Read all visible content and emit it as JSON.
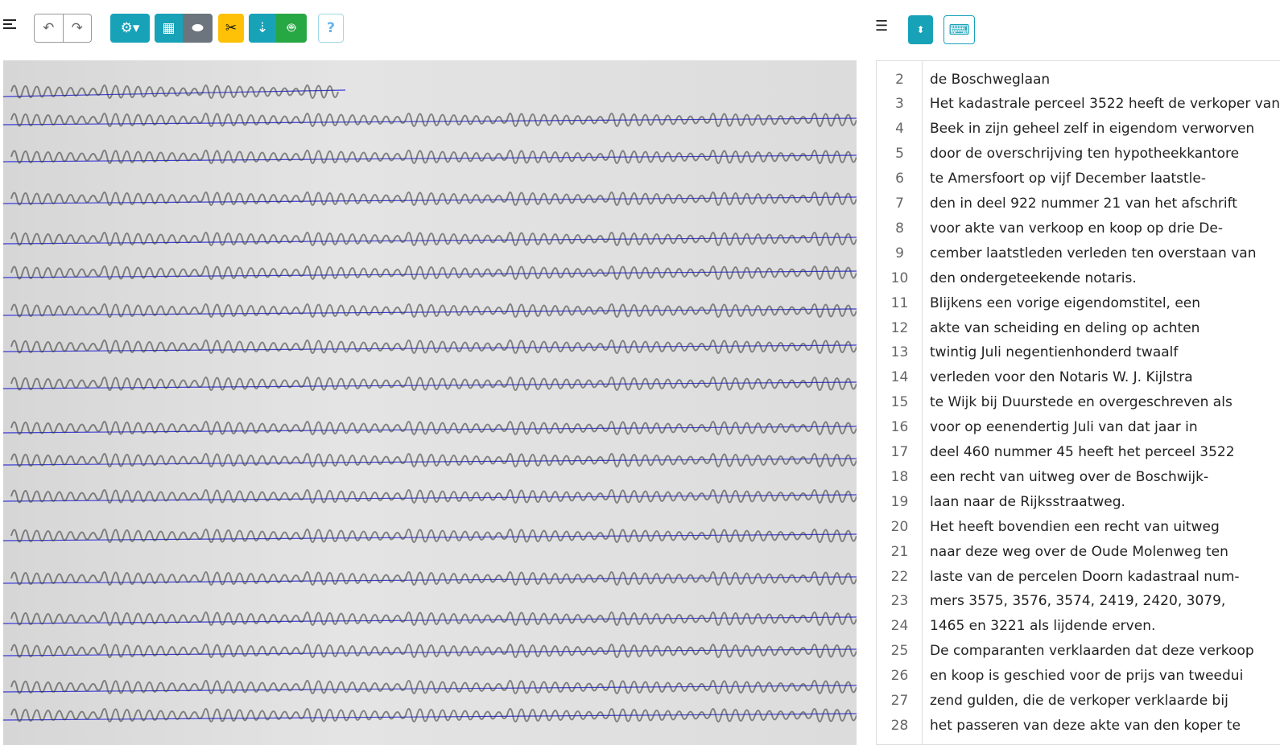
{
  "toolbar": {
    "help_label": "?",
    "colors": {
      "teal": "#17a2b8",
      "gray": "#6c757d",
      "yellow": "#ffc107",
      "green": "#28a745"
    }
  },
  "lines": [
    {
      "n": "2",
      "t": "de Boschweglaan"
    },
    {
      "n": "3",
      "t": "Het kadastrale perceel 3522 heeft de verkoper van"
    },
    {
      "n": "4",
      "t": "Beek in zijn geheel zelf in eigendom verworven"
    },
    {
      "n": "5",
      "t": "door de overschrijving ten hypotheekkantore"
    },
    {
      "n": "6",
      "t": "te Amersfoort op vijf December laatstle-"
    },
    {
      "n": "7",
      "t": "den in deel 922 nummer 21 van het afschrift"
    },
    {
      "n": "8",
      "t": "voor akte van verkoop en koop op drie De-"
    },
    {
      "n": "9",
      "t": "cember laatstleden verleden ten overstaan van"
    },
    {
      "n": "10",
      "t": "den ondergeteekende notaris."
    },
    {
      "n": "11",
      "t": "Blijkens een vorige eigendomstitel, een"
    },
    {
      "n": "12",
      "t": "akte van scheiding en deling op achten"
    },
    {
      "n": "13",
      "t": "twintig Juli negentienhonderd twaalf"
    },
    {
      "n": "14",
      "t": "verleden voor den Notaris W. J. Kijlstra"
    },
    {
      "n": "15",
      "t": "te Wijk bij Duurstede en overgeschreven als"
    },
    {
      "n": "16",
      "t": "voor op eenendertig Juli van dat jaar in"
    },
    {
      "n": "17",
      "t": "deel 460 nummer 45 heeft het perceel 3522"
    },
    {
      "n": "18",
      "t": "een recht van uitweg over de Boschwijk-"
    },
    {
      "n": "19",
      "t": "laan naar de Rijksstraatweg."
    },
    {
      "n": "20",
      "t": "Het heeft bovendien een recht van uitweg"
    },
    {
      "n": "21",
      "t": "naar deze weg over de Oude Molenweg ten"
    },
    {
      "n": "22",
      "t": "laste van de percelen Doorn kadastraal num-"
    },
    {
      "n": "23",
      "t": "mers 3575, 3576, 3574, 2419, 2420, 3079,"
    },
    {
      "n": "24",
      "t": "1465 en 3221 als lijdende erven."
    },
    {
      "n": "25",
      "t": "De comparanten verklaarden dat deze verkoop"
    },
    {
      "n": "26",
      "t": "en koop is geschied voor de prijs van tweedui"
    },
    {
      "n": "27",
      "t": "zend gulden, die de verkoper verklaarde bij"
    },
    {
      "n": "28",
      "t": "het passeren van deze akte van den koper te"
    }
  ]
}
